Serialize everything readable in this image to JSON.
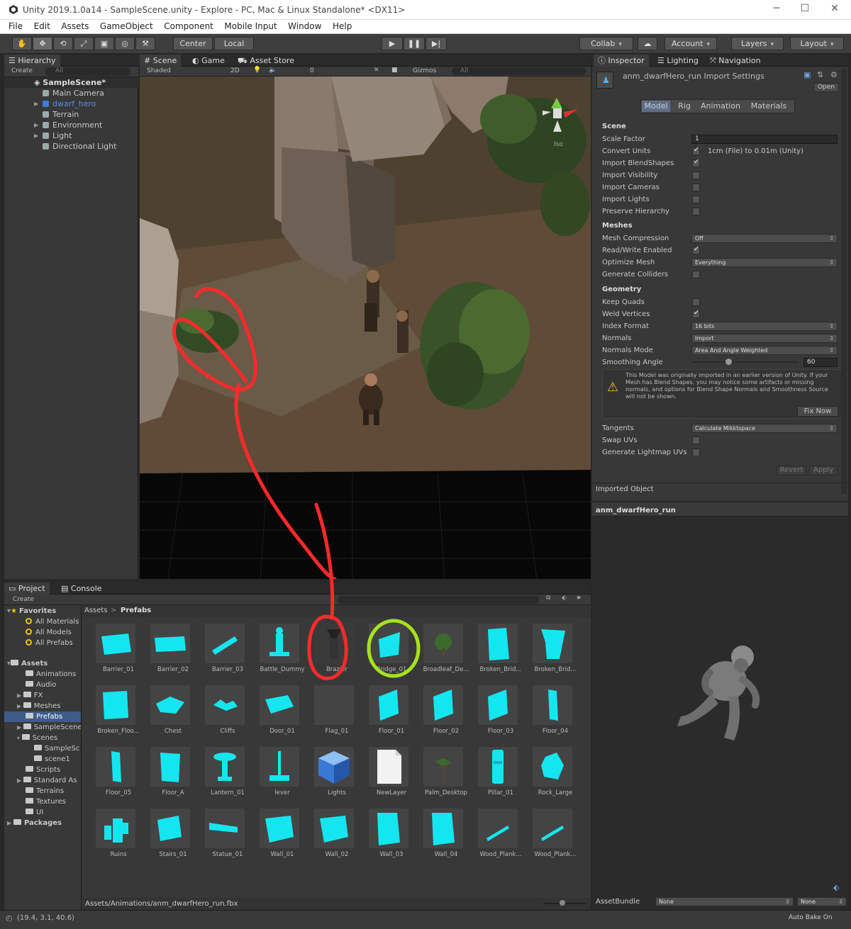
{
  "window": {
    "title": "Unity 2019.1.0a14 - SampleScene.unity - Explore - PC, Mac & Linux Standalone* <DX11>"
  },
  "menu": [
    "File",
    "Edit",
    "Assets",
    "GameObject",
    "Component",
    "Mobile Input",
    "Window",
    "Help"
  ],
  "toolbar": {
    "center": "Center",
    "local": "Local",
    "collab": "Collab",
    "account": "Account",
    "layers": "Layers",
    "layout": "Layout"
  },
  "hierarchy": {
    "tab": "Hierarchy",
    "create": "Create",
    "search": "All",
    "scene": "SampleScene*",
    "items": [
      "Main Camera",
      "dwarf_hero",
      "Terrain",
      "Environment",
      "Light",
      "Directional Light"
    ]
  },
  "scene": {
    "tabs": [
      "Scene",
      "Game",
      "Asset Store"
    ],
    "shading": "Shaded",
    "mode2d": "2D",
    "gizmos": "Gizmos",
    "search": "All",
    "iso": "Iso",
    "hidden_count": "0"
  },
  "inspector": {
    "tabs": [
      "Inspector",
      "Lighting",
      "Navigation"
    ],
    "asset_title": "anm_dwarfHero_run Import Settings",
    "open": "Open",
    "subtabs": [
      "Model",
      "Rig",
      "Animation",
      "Materials"
    ],
    "scene_header": "Scene",
    "scale_factor_label": "Scale Factor",
    "scale_factor": "1",
    "convert_units_label": "Convert Units",
    "convert_units_text": "1cm (File) to 0.01m (Unity)",
    "import_blendshapes": "Import BlendShapes",
    "import_visibility": "Import Visibility",
    "import_cameras": "Import Cameras",
    "import_lights": "Import Lights",
    "preserve_hierarchy": "Preserve Hierarchy",
    "meshes_header": "Meshes",
    "mesh_compression_label": "Mesh Compression",
    "mesh_compression": "Off",
    "read_write": "Read/Write Enabled",
    "optimize_mesh_label": "Optimize Mesh",
    "optimize_mesh": "Everything",
    "generate_colliders": "Generate Colliders",
    "geometry_header": "Geometry",
    "keep_quads": "Keep Quads",
    "weld_vertices": "Weld Vertices",
    "index_format_label": "Index Format",
    "index_format": "16 bits",
    "normals_label": "Normals",
    "normals": "Import",
    "normals_mode_label": "Normals Mode",
    "normals_mode": "Area And Angle Weighted",
    "smoothing_angle_label": "Smoothing Angle",
    "smoothing_angle": "60",
    "warning": "This Model was originally imported in an earlier version of Unity. If your Mesh has Blend Shapes, you may notice some artifacts or missing normals, and options for Blend Shape Normals and Smoothness Source will not be shown.",
    "fix_now": "Fix Now",
    "tangents_label": "Tangents",
    "tangents": "Calculate Mikktspace",
    "swap_uvs": "Swap UVs",
    "generate_lightmap_uvs": "Generate Lightmap UVs",
    "revert": "Revert",
    "apply": "Apply",
    "imported_object": "Imported Object"
  },
  "preview": {
    "title": "anm_dwarfHero_run",
    "assetbundle_label": "AssetBundle",
    "assetbundle": "None",
    "variant": "None",
    "auto_bake": "Auto Bake On"
  },
  "project": {
    "tabs": [
      "Project",
      "Console"
    ],
    "create": "Create",
    "breadcrumb_root": "Assets",
    "breadcrumb_current": "Prefabs",
    "path": "Assets/Animations/anm_dwarfHero_run.fbx",
    "favorites": "Favorites",
    "fav_items": [
      "All Materials",
      "All Models",
      "All Prefabs"
    ],
    "assets_root": "Assets",
    "folders": [
      "Animations",
      "Audio",
      "FX",
      "Meshes",
      "Prefabs",
      "SampleScene",
      "Scenes",
      "SampleSc",
      "scene1",
      "Scripts",
      "Standard As",
      "Terrains",
      "Textures",
      "UI"
    ],
    "packages": "Packages",
    "assets": [
      "Barrier_01",
      "Barrier_02",
      "Barrier_03",
      "Battle_Dummy",
      "Brazier",
      "Bridge_01",
      "Broadleaf_De...",
      "Broken_Brid...",
      "Broken_Brid...",
      "Broken_Floo...",
      "Chest",
      "Cliffs",
      "Door_01",
      "Flag_01",
      "Floor_01",
      "Floor_02",
      "Floor_03",
      "Floor_04",
      "Floor_05",
      "Floor_A",
      "Lantern_01",
      "lever",
      "Lights",
      "NewLayer",
      "Palm_Desktop",
      "Pillar_01",
      "Rock_Large",
      "Ruins",
      "Stairs_01",
      "Statue_01",
      "Wall_01",
      "Wall_02",
      "Wall_03",
      "Wall_04",
      "Wood_Plank...",
      "Wood_Plank..."
    ]
  },
  "status": {
    "coords": "(19.4, 3.1, 40.6)"
  },
  "colors": {
    "accent_cyan": "#14e6f0",
    "annotation_red": "#ff2a2a",
    "annotation_green": "#a6e21a",
    "selection": "#3d5c88"
  }
}
